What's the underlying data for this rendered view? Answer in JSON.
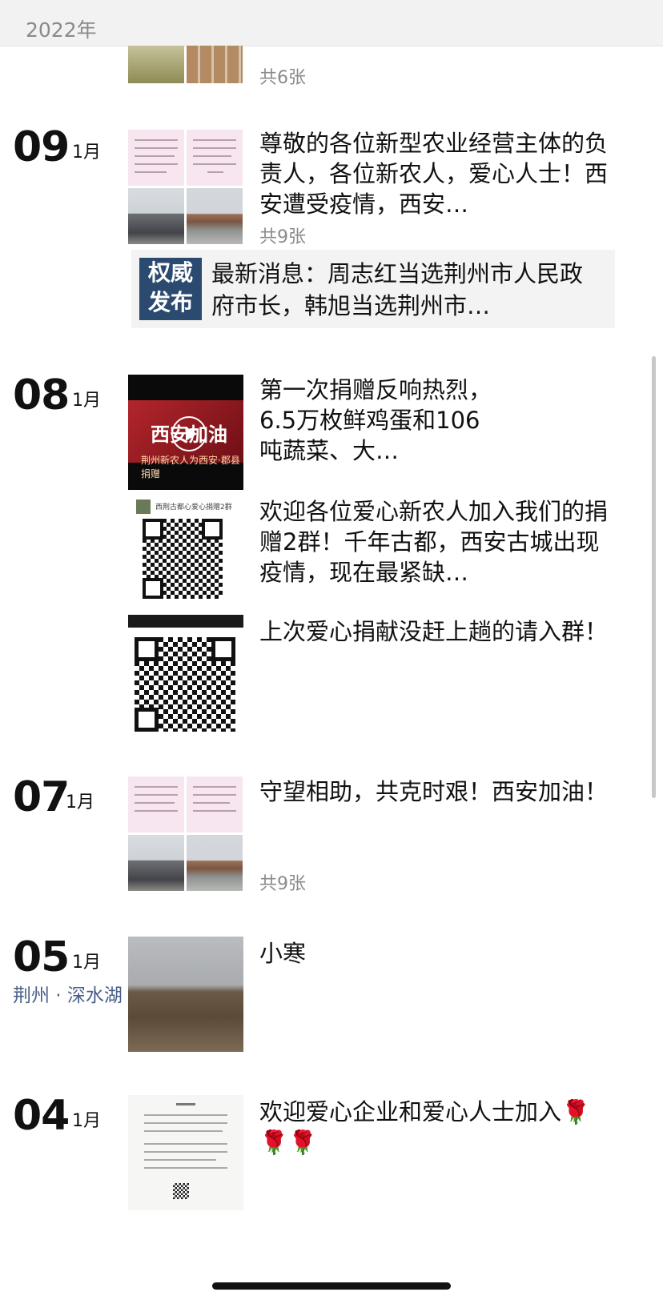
{
  "year_header": "2022年",
  "posts": [
    {
      "count": "共6张"
    },
    {
      "day": "09",
      "month": "1月",
      "text": "尊敬的各位新型农业经营主体的负责人，各位新农人，爱心人士！西安遭受疫情，西安…",
      "count": "共9张",
      "article": {
        "logo_line1": "权威",
        "logo_line2": "发布",
        "text": "最新消息：周志红当选荆州市人民政府市长，韩旭当选荆州市…"
      }
    },
    {
      "day": "08",
      "month": "1月",
      "video_text": "第一次捐赠反响热烈，6.5万枚鲜鸡蛋和106吨蔬菜、大…",
      "video_title": "西安加油",
      "video_sub": "荆州新农人为西安·郡县捐赠",
      "qr_text1": "欢迎各位爱心新农人加入我们的捐赠2群！千年古都，西安古城出现疫情，现在最紧缺…",
      "qr_label": "西荆古都心爱心捐赠2群",
      "qr_text2": "上次爱心捐献没赶上趟的请入群！"
    },
    {
      "day": "07",
      "month": "1月",
      "text": "守望相助，共克时艰！西安加油！",
      "count": "共9张"
    },
    {
      "day": "05",
      "month": "1月",
      "location": "荆州 · 深水湖",
      "text": "小寒"
    },
    {
      "day": "04",
      "month": "1月",
      "text": "欢迎爱心企业和爱心人士加入🌹🌹🌹"
    }
  ]
}
